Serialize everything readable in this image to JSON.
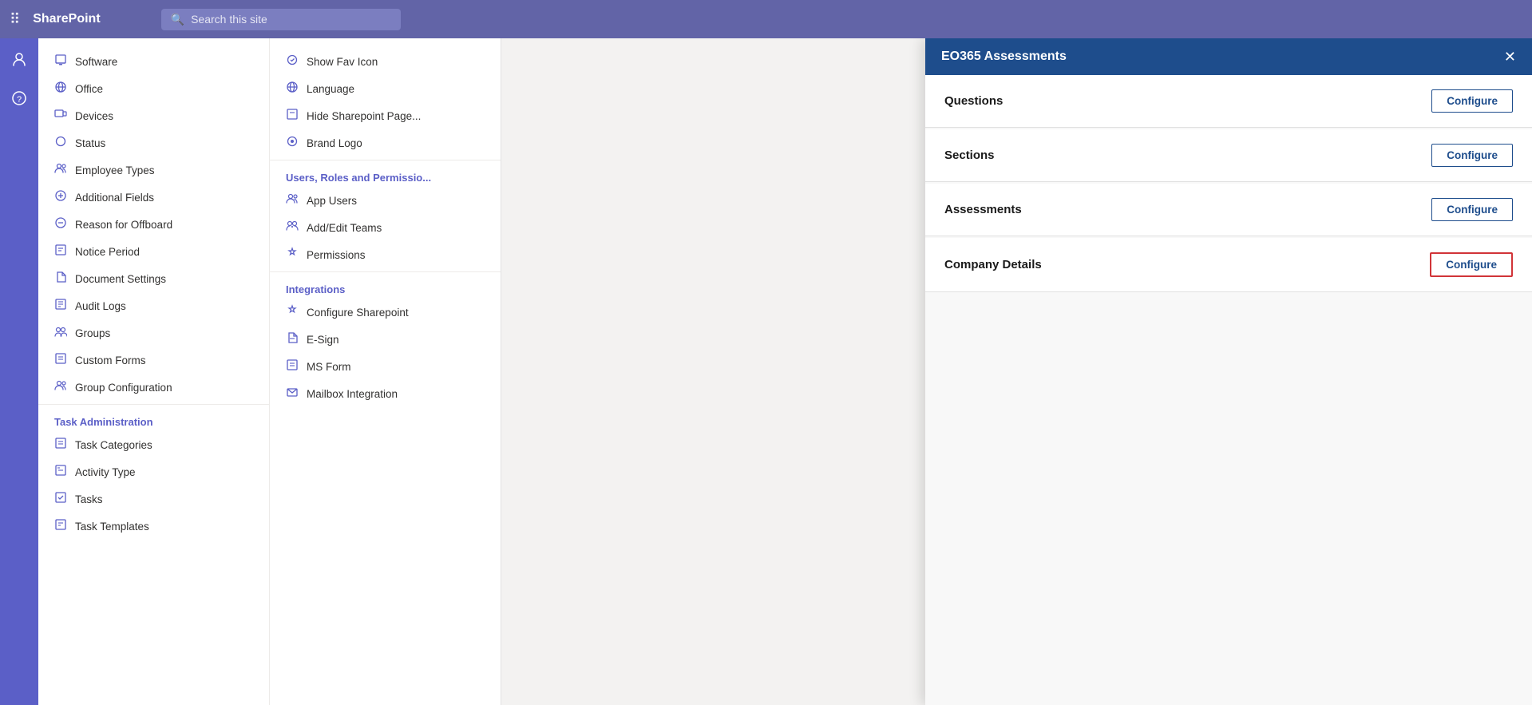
{
  "topbar": {
    "title": "SharePoint",
    "search_placeholder": "Search this site"
  },
  "sidebar_narrow": {
    "icons": [
      {
        "name": "people-icon",
        "glyph": "👤"
      },
      {
        "name": "help-icon",
        "glyph": "?"
      }
    ]
  },
  "menu_col1": {
    "items": [
      {
        "label": "Software",
        "icon": "💾"
      },
      {
        "label": "Office",
        "icon": "🌐"
      },
      {
        "label": "Devices",
        "icon": "🖥"
      },
      {
        "label": "Status",
        "icon": "⚪"
      },
      {
        "label": "Employee Types",
        "icon": "👥"
      },
      {
        "label": "Additional Fields",
        "icon": "⚙"
      },
      {
        "label": "Reason for Offboard",
        "icon": "⚙"
      },
      {
        "label": "Notice Period",
        "icon": "📋"
      },
      {
        "label": "Document Settings",
        "icon": "📄"
      },
      {
        "label": "Audit Logs",
        "icon": "📋"
      },
      {
        "label": "Groups",
        "icon": "⚙"
      },
      {
        "label": "Custom Forms",
        "icon": "📋"
      },
      {
        "label": "Group Configuration",
        "icon": "👥"
      }
    ],
    "section_header": "Task Administration",
    "section_items": [
      {
        "label": "Task Categories",
        "icon": "📋"
      },
      {
        "label": "Activity Type",
        "icon": "📝"
      },
      {
        "label": "Tasks",
        "icon": "☑"
      },
      {
        "label": "Task Templates",
        "icon": "📋"
      }
    ]
  },
  "menu_col2": {
    "appearance_items": [
      {
        "label": "Show Fav Icon",
        "icon": "⚙"
      },
      {
        "label": "Language",
        "icon": "⚙"
      },
      {
        "label": "Hide Sharepoint Page...",
        "icon": "📋"
      },
      {
        "label": "Brand Logo",
        "icon": "⚙"
      }
    ],
    "users_section_header": "Users, Roles and Permissio...",
    "users_items": [
      {
        "label": "App Users",
        "icon": "👥"
      },
      {
        "label": "Add/Edit Teams",
        "icon": "👥"
      },
      {
        "label": "Permissions",
        "icon": "🔑"
      }
    ],
    "integrations_header": "Integrations",
    "integrations_items": [
      {
        "label": "Configure Sharepoint",
        "icon": "🔑"
      },
      {
        "label": "E-Sign",
        "icon": "📄"
      },
      {
        "label": "MS Form",
        "icon": "📊"
      },
      {
        "label": "Mailbox Integration",
        "icon": "✉"
      }
    ]
  },
  "panel": {
    "title": "EO365 Assessments",
    "close_label": "✕",
    "rows": [
      {
        "label": "Questions",
        "button": "Configure",
        "highlighted": false
      },
      {
        "label": "Sections",
        "button": "Configure",
        "highlighted": false
      },
      {
        "label": "Assessments",
        "button": "Configure",
        "highlighted": false
      },
      {
        "label": "Company Details",
        "button": "Configure",
        "highlighted": true
      }
    ]
  }
}
